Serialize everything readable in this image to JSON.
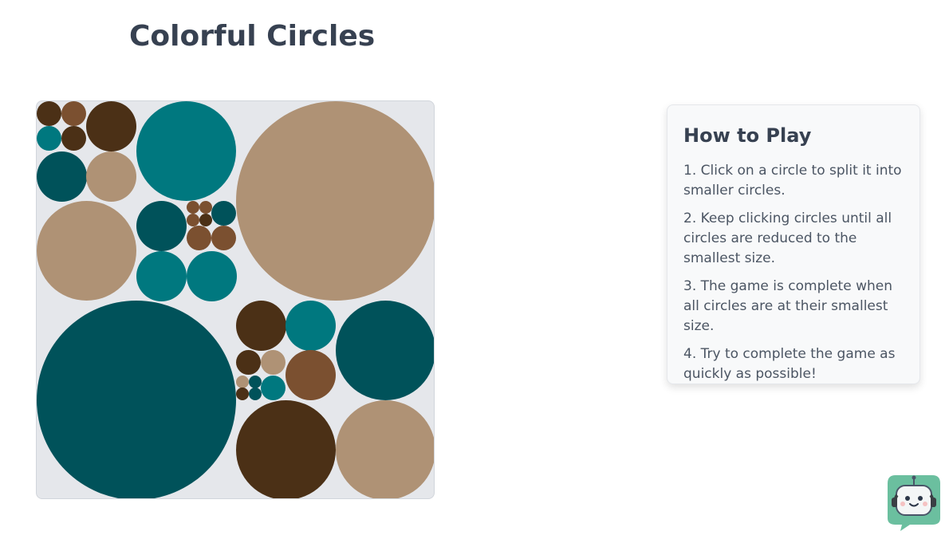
{
  "title": "Colorful Circles",
  "colors": {
    "teal": "#00787f",
    "dark_teal": "#00525a",
    "tan": "#af9275",
    "dark_brown": "#4b3016",
    "brown": "#7b5030"
  },
  "instructions": {
    "heading": "How to Play",
    "steps": [
      "1. Click on a circle to split it into smaller circles.",
      "2. Keep clicking circles until all circles are reduced to the smallest size.",
      "3. The game is complete when all circles are at their smallest size.",
      "4. Try to complete the game as quickly as possible!"
    ]
  },
  "assistant": {
    "icon": "chatbot-icon"
  }
}
